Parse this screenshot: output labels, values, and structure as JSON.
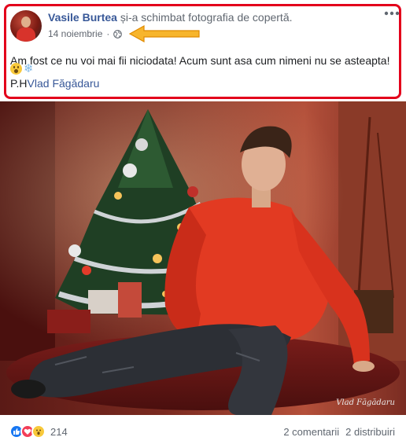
{
  "post": {
    "author": "Vasile Burtea",
    "action": " și-a schimbat fotografia de copertă.",
    "date": "14 noiembrie",
    "privacy_icon": "globe-icon",
    "more_icon": "more-options-icon",
    "text": "Am fost ce nu voi mai fii niciodata! Acum sunt asa cum nimeni nu se asteapta!",
    "emojis": [
      "surprised-emoji",
      "snowflake-emoji"
    ],
    "credit_prefix": "P.H",
    "credit_link": "Vlad Făgădaru"
  },
  "annotation": {
    "highlight_color": "#e3001b",
    "arrow_color": "#f5a623"
  },
  "photo": {
    "watermark": "Vlad Făgădaru"
  },
  "footer": {
    "reaction_icons": [
      "like-icon",
      "love-icon",
      "wow-icon"
    ],
    "reaction_count": "214",
    "comments": "2 comentarii",
    "shares": "2 distribuiri"
  },
  "colors": {
    "link": "#385898",
    "muted": "#606770",
    "like": "#1877f2",
    "love": "#f33e58",
    "wow": "#f8c93b"
  }
}
